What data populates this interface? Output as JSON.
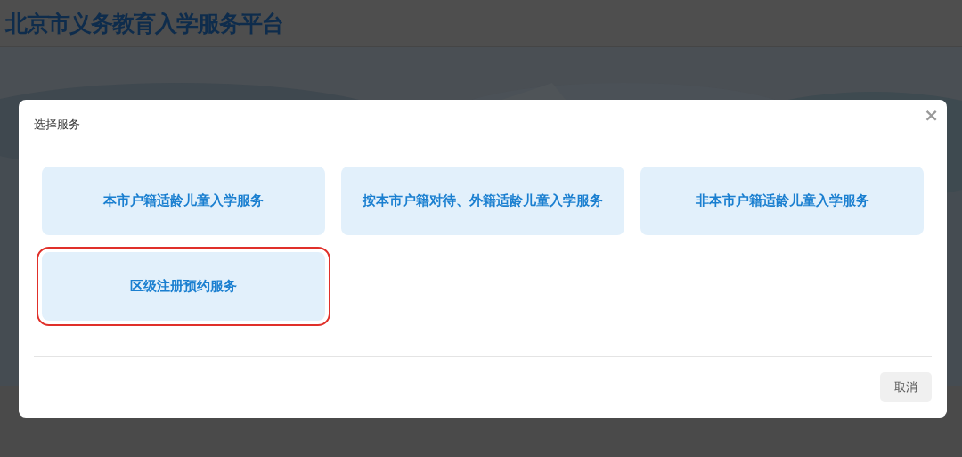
{
  "header": {
    "title": "北京市义务教育入学服务平台"
  },
  "dialog": {
    "title": "选择服务",
    "close": "×",
    "options": [
      {
        "label": "本市户籍适龄儿童入学服务",
        "highlighted": false
      },
      {
        "label": "按本市户籍对待、外籍适龄儿童入学服务",
        "highlighted": false
      },
      {
        "label": "非本市户籍适龄儿童入学服务",
        "highlighted": false
      },
      {
        "label": "区级注册预约服务",
        "highlighted": true
      }
    ],
    "buttons": [
      "取消"
    ]
  }
}
